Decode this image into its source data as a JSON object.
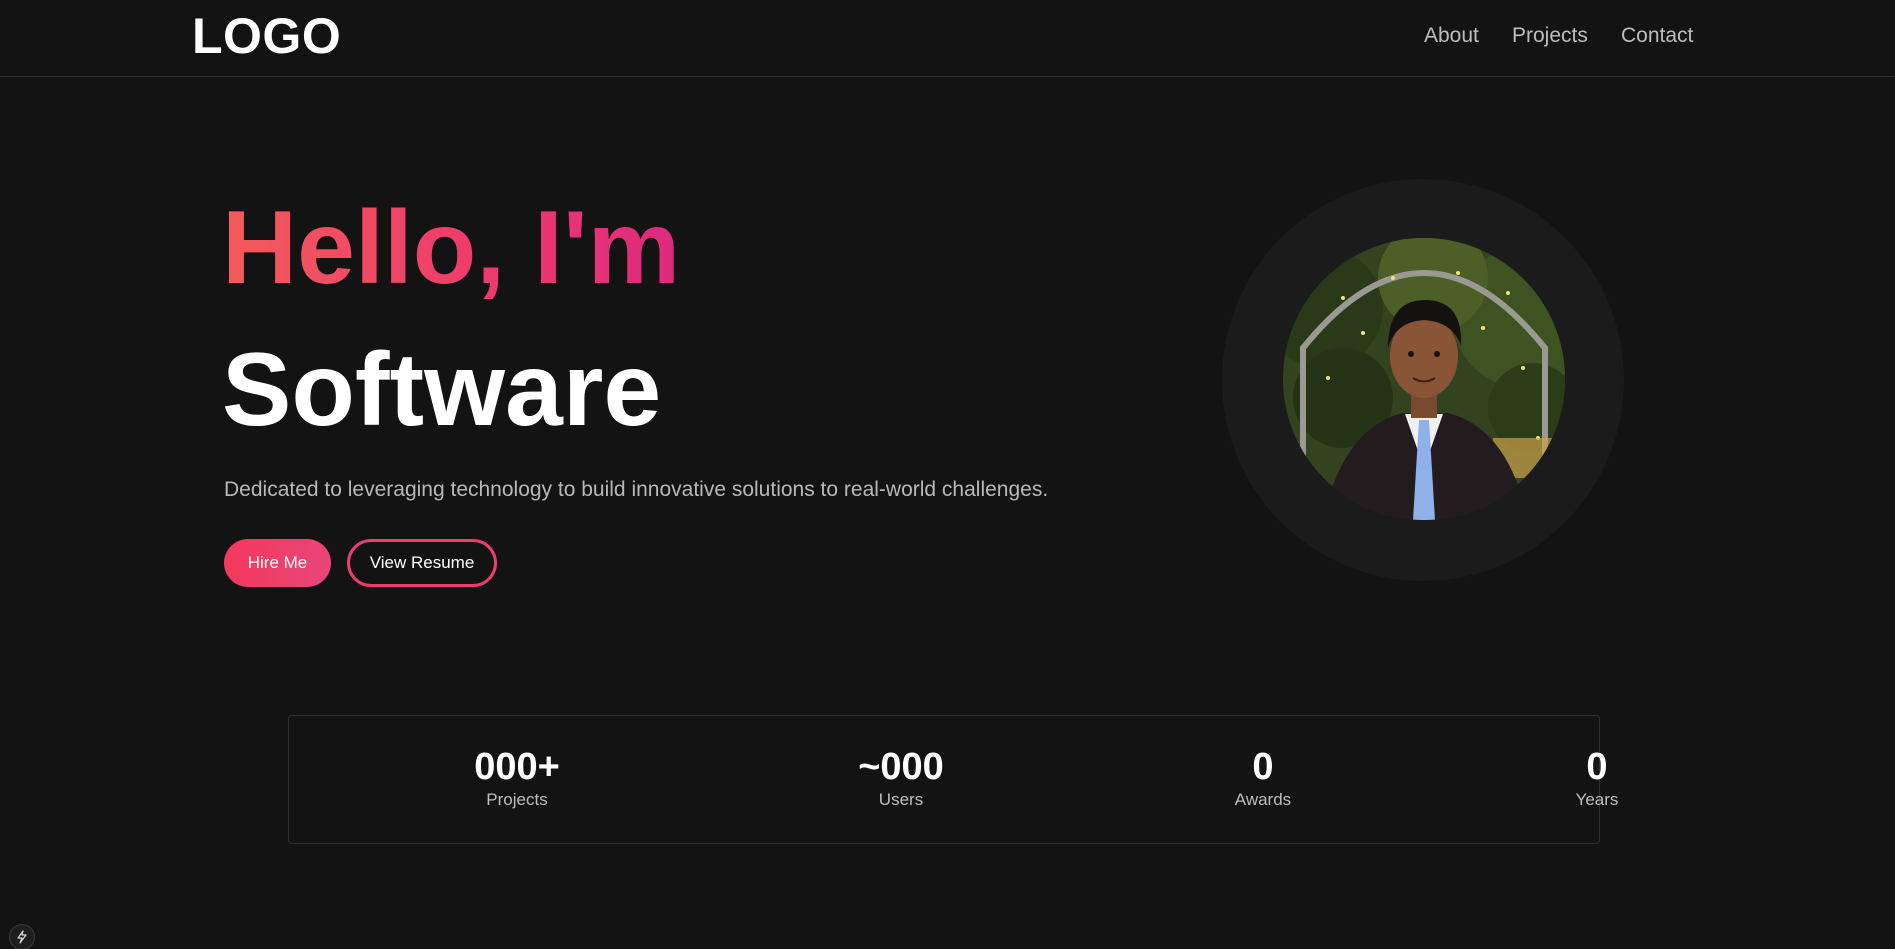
{
  "header": {
    "logo": "LOGO",
    "nav": [
      {
        "label": "About"
      },
      {
        "label": "Projects"
      },
      {
        "label": "Contact"
      }
    ]
  },
  "hero": {
    "greeting": "Hello, I'm",
    "role": "Software",
    "description": "Dedicated to leveraging technology to build innovative solutions to real-world challenges.",
    "buttons": {
      "hire": "Hire Me",
      "resume": "View Resume"
    }
  },
  "profile": {
    "photo_icon": "profile-photo"
  },
  "stats": [
    {
      "value": "000+",
      "label": "Projects"
    },
    {
      "value": "~000",
      "label": "Users"
    },
    {
      "value": "0",
      "label": "Awards"
    },
    {
      "value": "0",
      "label": "Years"
    }
  ],
  "corner": {
    "icon": "lightning-icon"
  },
  "colors": {
    "background": "#131313",
    "accent_start": "#f45b5b",
    "accent_end": "#de2a7e",
    "button": "#f23a5c",
    "text_muted": "#bdbdbd"
  }
}
